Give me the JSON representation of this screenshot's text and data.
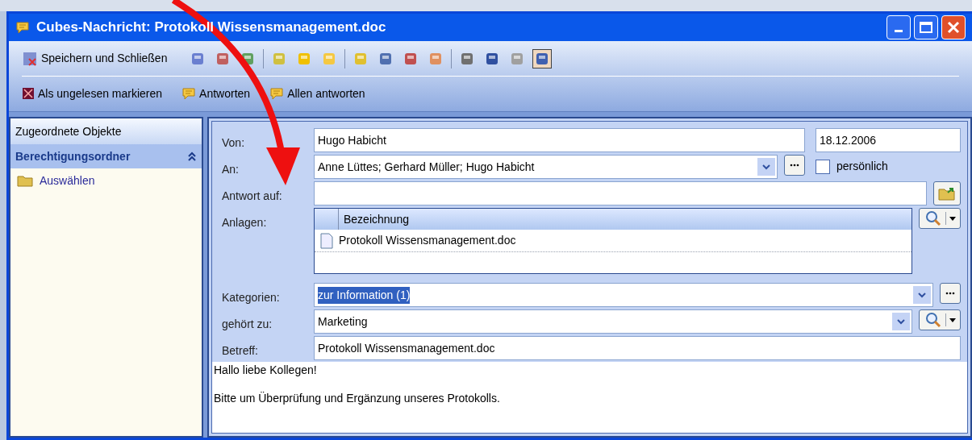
{
  "window": {
    "title": "Cubes-Nachricht: Protokoll Wissensmanagement.doc"
  },
  "toolbar": {
    "save_close": "Speichern und Schließen"
  },
  "actions": [
    {
      "kind": "unread",
      "label": "Als ungelesen markieren"
    },
    {
      "kind": "reply",
      "label": "Antworten"
    },
    {
      "kind": "reply",
      "label": "Allen antworten"
    }
  ],
  "sidebar": {
    "title": "Zugeordnete Objekte",
    "section": {
      "label": "Berechtigungsordner",
      "expanded": true,
      "items": [
        "Auswählen"
      ]
    }
  },
  "form": {
    "von": {
      "label": "Von:",
      "value": "Hugo Habicht",
      "date": "18.12.2006"
    },
    "an": {
      "label": "An:",
      "value": "Anne Lüttes; Gerhard Müller; Hugo Habicht",
      "personal": {
        "label": "persönlich",
        "checked": false
      }
    },
    "antwort": {
      "label": "Antwort auf:"
    },
    "anlagen": {
      "label": "Anlagen:",
      "column": "Bezeichnung",
      "rows": [
        "Protokoll Wissensmanagement.doc"
      ]
    },
    "kategorien": {
      "label": "Kategorien:",
      "value": "zur Information (1)",
      "highlighted": true
    },
    "gehoert": {
      "label": "gehört zu:",
      "value": "Marketing"
    },
    "betreff": {
      "label": "Betreff:",
      "value": "Protokoll Wissensmanagement.doc"
    }
  },
  "body": [
    "Hallo liebe Kollegen!",
    "Bitte um Überprüfung und Ergänzung unseres Protokolls."
  ]
}
